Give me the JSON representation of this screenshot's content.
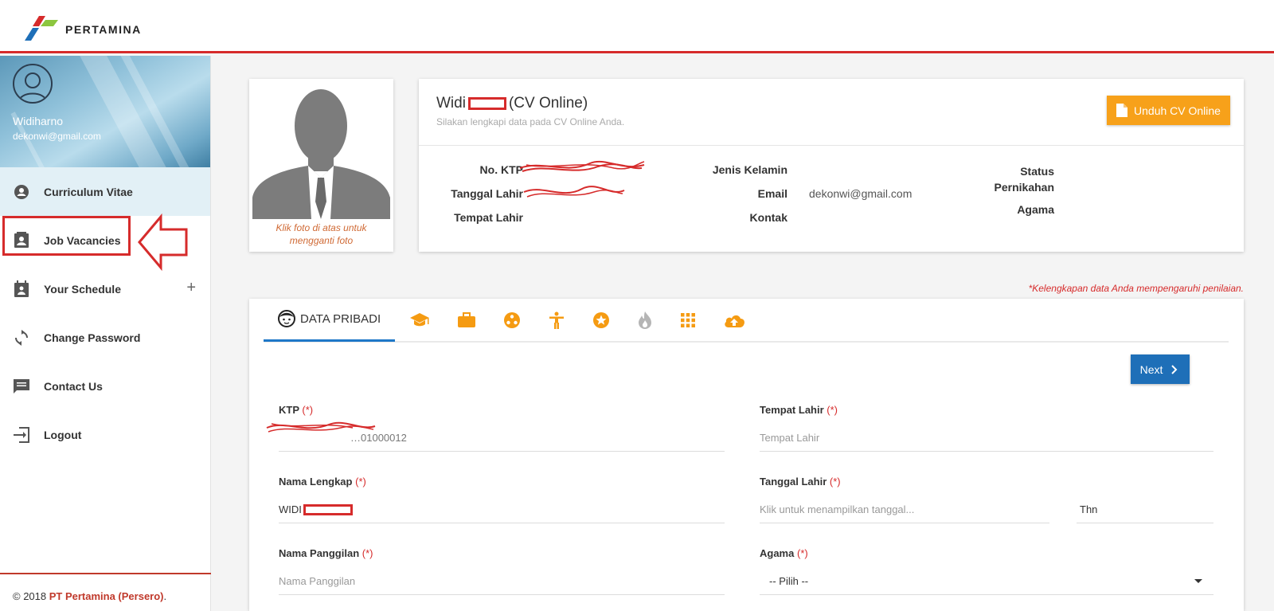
{
  "header": {
    "logo_text": "PERTAMINA"
  },
  "sidebar": {
    "user_name": "Widiharno",
    "user_email": "dekonwi@gmail.com",
    "items": [
      {
        "label": "Curriculum Vitae",
        "icon": "person-pin-icon"
      },
      {
        "label": "Job Vacancies",
        "icon": "contact-card-icon"
      },
      {
        "label": "Your Schedule",
        "icon": "calendar-icon",
        "expand": "+"
      },
      {
        "label": "Change Password",
        "icon": "refresh-icon"
      },
      {
        "label": "Contact Us",
        "icon": "message-icon"
      },
      {
        "label": "Logout",
        "icon": "logout-icon"
      }
    ],
    "footer": {
      "prefix": "© 2018 ",
      "brand": "PT Pertamina (Persero)",
      "suffix": "."
    }
  },
  "photo": {
    "caption": "Klik foto di atas untuk mengganti foto"
  },
  "profile": {
    "name": "Widi",
    "name_suffix": "(CV Online)",
    "subtitle": "Silakan lengkapi data pada CV Online Anda.",
    "download_label": "Unduh CV Online",
    "labels": {
      "ktp": "No. KTP",
      "birth_date": "Tanggal Lahir",
      "birth_place": "Tempat Lahir",
      "gender": "Jenis Kelamin",
      "email": "Email",
      "contact": "Kontak",
      "marital_status": "Status Pernikahan",
      "religion": "Agama"
    },
    "email_value": "dekonwi@gmail.com"
  },
  "note": "*Kelengkapan data Anda mempengaruhi penilaian.",
  "form": {
    "active_tab": "DATA PRIBADI",
    "tabs": [
      "personal-data-icon",
      "education-icon",
      "work-icon",
      "organization-icon",
      "skills-icon",
      "achievement-icon",
      "interest-icon",
      "apps-icon",
      "upload-icon"
    ],
    "next_label": "Next",
    "required_mark": "(*)",
    "fields": {
      "ktp": {
        "label": "KTP",
        "value": "…01000012"
      },
      "full_name": {
        "label": "Nama Lengkap",
        "value": "WIDI"
      },
      "nickname": {
        "label": "Nama Panggilan",
        "placeholder": "Nama Panggilan"
      },
      "birth_place": {
        "label": "Tempat Lahir",
        "placeholder": "Tempat Lahir"
      },
      "birth_date": {
        "label": "Tanggal Lahir",
        "placeholder": "Klik untuk menampilkan tanggal...",
        "year_placeholder": "Thn"
      },
      "religion": {
        "label": "Agama",
        "selected": "-- Pilih --"
      }
    }
  },
  "colors": {
    "accent": "#f59b12",
    "brand_red": "#d62b2b",
    "primary_blue": "#1e6fb8"
  }
}
